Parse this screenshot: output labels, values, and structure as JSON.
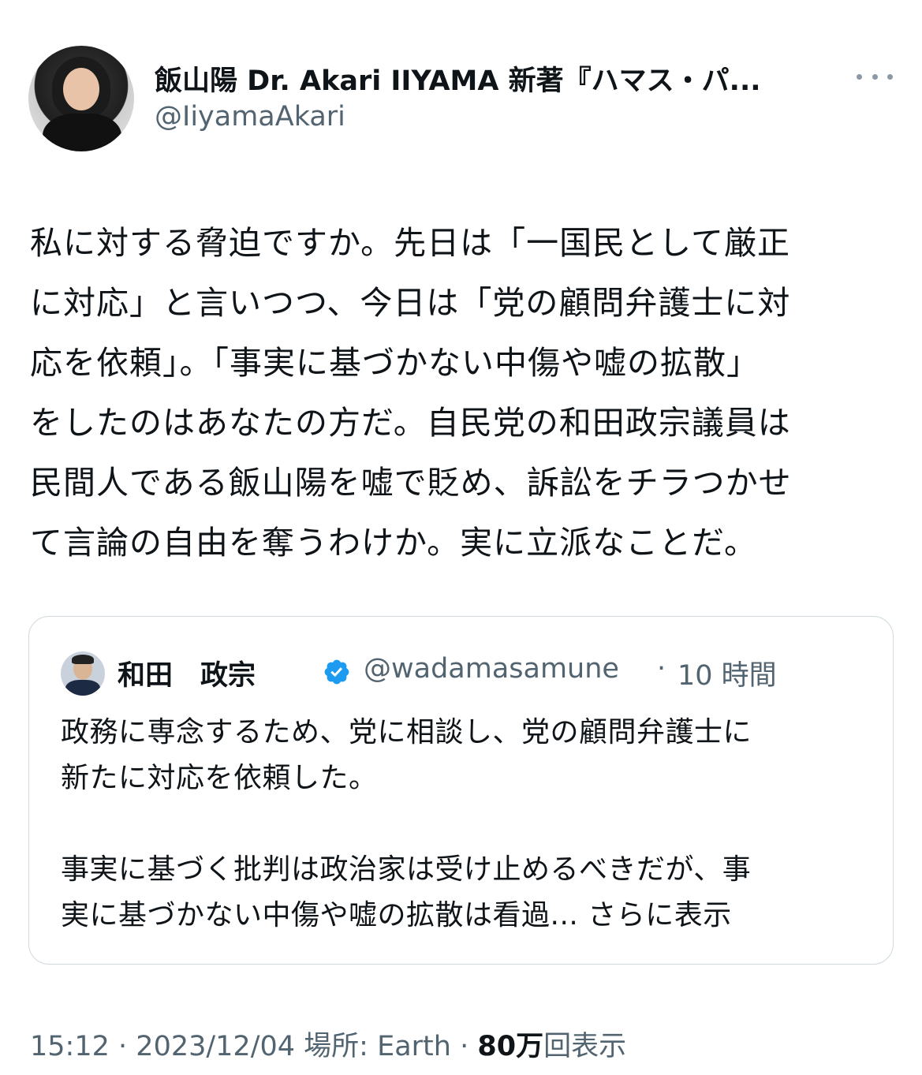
{
  "author": {
    "display_name": "飯山陽 Dr. Akari IIYAMA 新著『ハマス・パ...",
    "handle": "@IiyamaAkari"
  },
  "tweet": {
    "lines": [
      "私に対する脅迫ですか。先日は「一国民として厳正",
      "に対応」と言いつつ、今日は「党の顧問弁護士に対",
      "応を依頼」。「事実に基づかない中傷や嘘の拡散」",
      "をしたのはあなたの方だ。自民党の和田政宗議員は",
      "民間人である飯山陽を嘘で貶め、訴訟をチラつかせ",
      "て言論の自由を奪うわけか。実に立派なことだ。"
    ]
  },
  "quote": {
    "name": "和田　政宗",
    "handle": "@wadamasamune",
    "separator": "·",
    "time": "10 時間",
    "paragraph1": [
      "政務に専念するため、党に相談し、党の顧問弁護士に",
      "新たに対応を依頼した。"
    ],
    "paragraph2_line1": "事実に基づく批判は政治家は受け止めるべきだが、事",
    "paragraph2_line2": "実に基づかない中傷や嘘の拡散は看過...",
    "show_more": "さらに表示",
    "verified_color": "#1d9bf0"
  },
  "meta": {
    "time": "15:12",
    "sep1": "·",
    "date": "2023/12/04",
    "location_label": "場所: Earth",
    "sep2": "·",
    "views_count": "80万",
    "views_label": "回表示"
  }
}
